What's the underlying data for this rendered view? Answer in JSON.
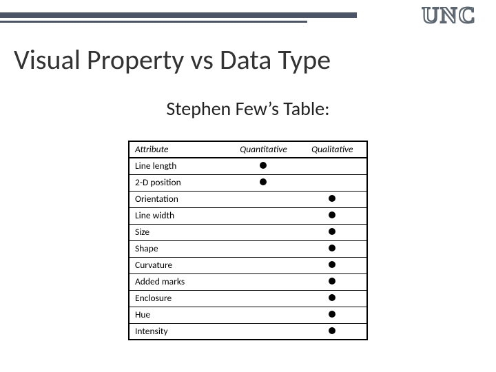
{
  "brand": "UNC",
  "title": "Visual Property vs Data Type",
  "subtitle": "Stephen Few’s Table:",
  "headers": {
    "attribute": "Attribute",
    "quantitative": "Quantitative",
    "qualitative": "Qualitative"
  },
  "rows": [
    {
      "attribute": "Line length",
      "quantitative": true,
      "qualitative": false
    },
    {
      "attribute": "2-D position",
      "quantitative": true,
      "qualitative": false
    },
    {
      "attribute": "Orientation",
      "quantitative": false,
      "qualitative": true
    },
    {
      "attribute": "Line width",
      "quantitative": false,
      "qualitative": true
    },
    {
      "attribute": "Size",
      "quantitative": false,
      "qualitative": true
    },
    {
      "attribute": "Shape",
      "quantitative": false,
      "qualitative": true
    },
    {
      "attribute": "Curvature",
      "quantitative": false,
      "qualitative": true
    },
    {
      "attribute": "Added marks",
      "quantitative": false,
      "qualitative": true
    },
    {
      "attribute": "Enclosure",
      "quantitative": false,
      "qualitative": true
    },
    {
      "attribute": "Hue",
      "quantitative": false,
      "qualitative": true
    },
    {
      "attribute": "Intensity",
      "quantitative": false,
      "qualitative": true
    }
  ],
  "chart_data": {
    "type": "table",
    "title": "Stephen Few’s Table",
    "columns": [
      "Attribute",
      "Quantitative",
      "Qualitative"
    ],
    "rows": [
      [
        "Line length",
        1,
        0
      ],
      [
        "2-D position",
        1,
        0
      ],
      [
        "Orientation",
        0,
        1
      ],
      [
        "Line width",
        0,
        1
      ],
      [
        "Size",
        0,
        1
      ],
      [
        "Shape",
        0,
        1
      ],
      [
        "Curvature",
        0,
        1
      ],
      [
        "Added marks",
        0,
        1
      ],
      [
        "Enclosure",
        0,
        1
      ],
      [
        "Hue",
        0,
        1
      ],
      [
        "Intensity",
        0,
        1
      ]
    ]
  }
}
